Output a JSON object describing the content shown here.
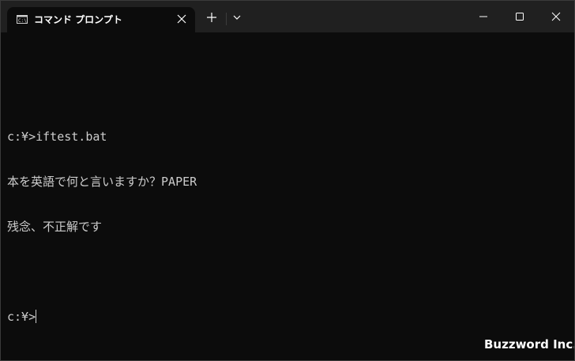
{
  "window": {
    "tab_title": "コマンド プロンプト",
    "tab_icon": "terminal-icon",
    "controls": [
      "minimize-icon",
      "maximize-icon",
      "close-icon"
    ]
  },
  "terminal": {
    "lines": [
      "",
      "c:¥>iftest.bat",
      "本を英語で何と言いますか？PAPER",
      "残念、不正解です",
      "",
      "c:¥>"
    ]
  },
  "watermark": "Buzzword Inc.",
  "colors": {
    "titlebar": "#202020",
    "background": "#0c0c0c",
    "text": "#cccccc"
  }
}
